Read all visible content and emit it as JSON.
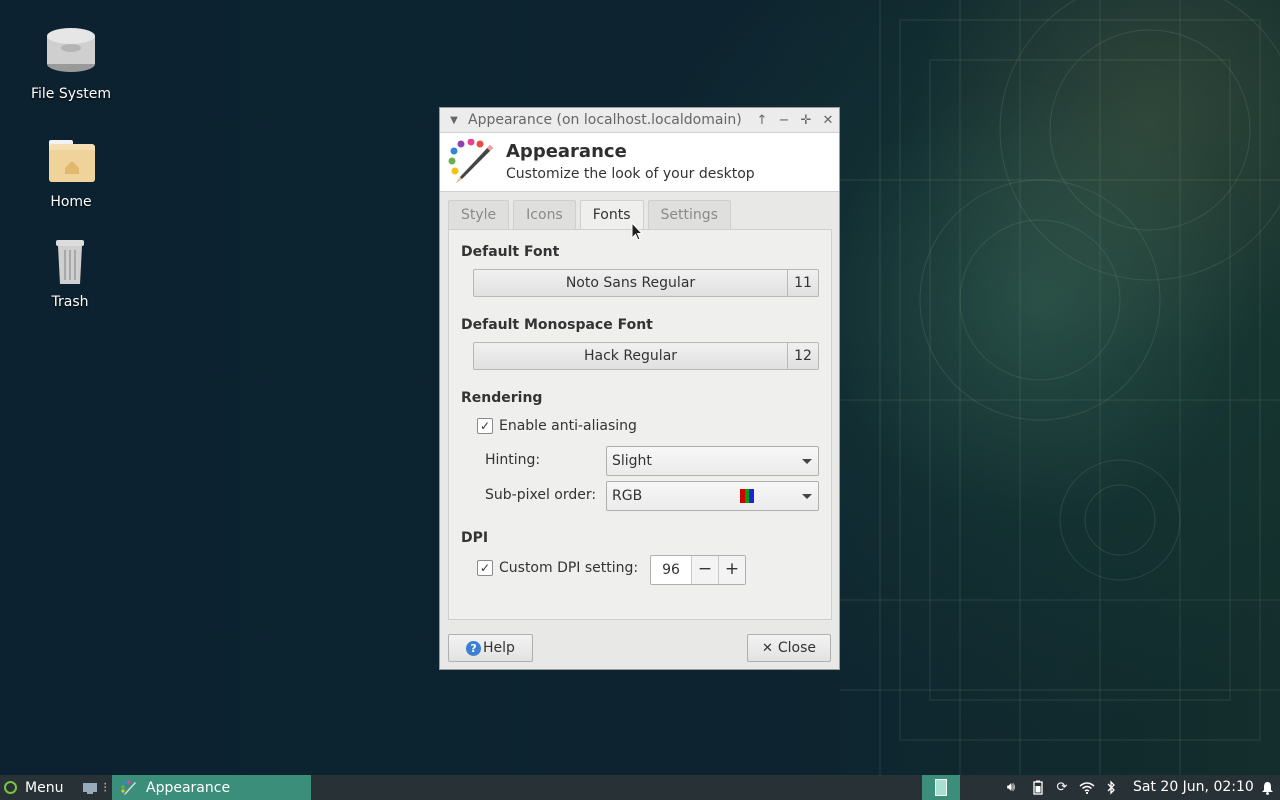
{
  "desktop": {
    "icons": [
      {
        "label": "File System"
      },
      {
        "label": "Home"
      },
      {
        "label": "Trash"
      }
    ]
  },
  "window": {
    "title": "Appearance (on localhost.localdomain)",
    "header": {
      "title": "Appearance",
      "subtitle": "Customize the look of your desktop"
    },
    "tabs": [
      {
        "label": "Style"
      },
      {
        "label": "Icons"
      },
      {
        "label": "Fonts",
        "active": true
      },
      {
        "label": "Settings"
      }
    ],
    "fonts": {
      "default_font_heading": "Default Font",
      "default_font_name": "Noto Sans Regular",
      "default_font_size": "11",
      "mono_font_heading": "Default Monospace Font",
      "mono_font_name": "Hack Regular",
      "mono_font_size": "12",
      "rendering_heading": "Rendering",
      "antialias_label": "Enable anti-aliasing",
      "antialias_checked": true,
      "hinting_label": "Hinting:",
      "hinting_value": "Slight",
      "subpixel_label": "Sub-pixel order:",
      "subpixel_value": "RGB",
      "dpi_heading": "DPI",
      "custom_dpi_label": "Custom DPI setting:",
      "custom_dpi_checked": true,
      "dpi_value": "96"
    },
    "buttons": {
      "help": "Help",
      "close": "Close"
    }
  },
  "taskbar": {
    "menu_label": "Menu",
    "app_label": "Appearance",
    "clock": "Sat 20 Jun, 02:10"
  },
  "colors": {
    "taskbar_bg": "#283136",
    "active_task": "#3b8f7a",
    "desktop_bg": "#0c2230",
    "menu_logo": "#7bc142"
  }
}
